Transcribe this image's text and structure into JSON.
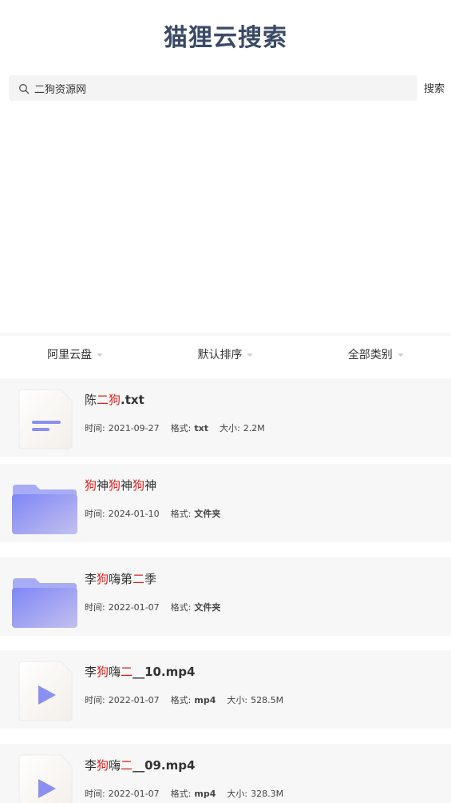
{
  "app": {
    "title": "猫狸云搜索"
  },
  "search": {
    "value": "二狗资源网",
    "button_label": "搜索"
  },
  "filters": [
    {
      "label": "阿里云盘"
    },
    {
      "label": "默认排序"
    },
    {
      "label": "全部类别"
    }
  ],
  "meta_labels": {
    "time": "时间:",
    "format": "格式:",
    "size": "大小:"
  },
  "results": [
    {
      "type": "document",
      "name_parts": [
        {
          "text": "陈",
          "hl": false
        },
        {
          "text": "二狗",
          "hl": true
        },
        {
          "text": ".txt",
          "hl": false,
          "ext": true
        }
      ],
      "time": "2021-09-27",
      "format": "txt",
      "size": "2.2M"
    },
    {
      "type": "folder",
      "name_parts": [
        {
          "text": "狗",
          "hl": true
        },
        {
          "text": "神",
          "hl": false
        },
        {
          "text": "狗",
          "hl": true
        },
        {
          "text": "神",
          "hl": false
        },
        {
          "text": "狗",
          "hl": true
        },
        {
          "text": "神",
          "hl": false
        }
      ],
      "time": "2024-01-10",
      "format": "文件夹",
      "size": null
    },
    {
      "type": "folder",
      "name_parts": [
        {
          "text": "李",
          "hl": false
        },
        {
          "text": "狗",
          "hl": true
        },
        {
          "text": "嗨第",
          "hl": false
        },
        {
          "text": "二",
          "hl": true
        },
        {
          "text": "季",
          "hl": false
        }
      ],
      "time": "2022-01-07",
      "format": "文件夹",
      "size": null
    },
    {
      "type": "video",
      "name_parts": [
        {
          "text": "李",
          "hl": false
        },
        {
          "text": "狗",
          "hl": true
        },
        {
          "text": "嗨",
          "hl": false
        },
        {
          "text": "二",
          "hl": true
        },
        {
          "text": "__10.mp4",
          "hl": false,
          "ext": true
        }
      ],
      "time": "2022-01-07",
      "format": "mp4",
      "size": "528.5M"
    },
    {
      "type": "video",
      "name_parts": [
        {
          "text": "李",
          "hl": false
        },
        {
          "text": "狗",
          "hl": true
        },
        {
          "text": "嗨",
          "hl": false
        },
        {
          "text": "二",
          "hl": true
        },
        {
          "text": "__09.mp4",
          "hl": false,
          "ext": true
        }
      ],
      "time": "2022-01-07",
      "format": "mp4",
      "size": "328.3M"
    }
  ]
}
